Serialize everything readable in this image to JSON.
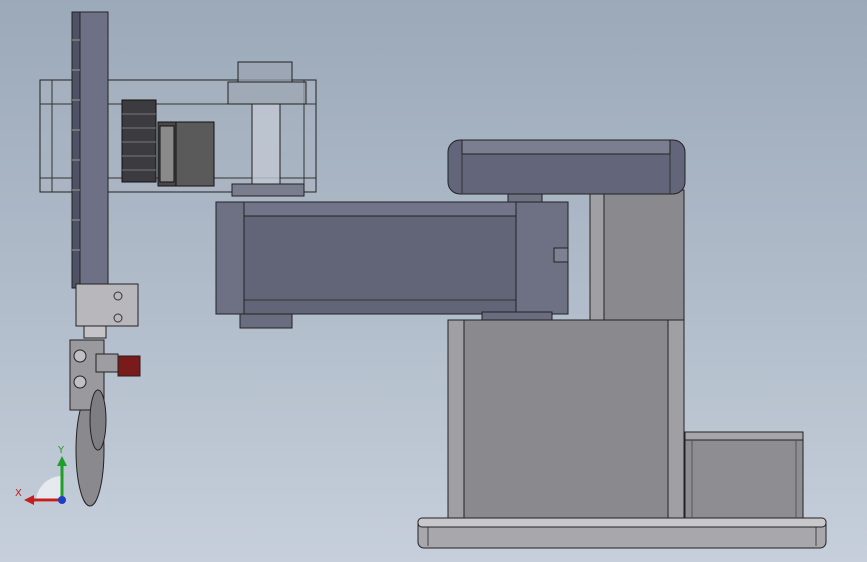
{
  "viewport": {
    "background_top": "#9ba9b9",
    "background_bottom": "#c6cfdb"
  },
  "model": {
    "parts": [
      "vertical-rack-shaft",
      "motor-gear-housing",
      "stepper-motor",
      "upper-arm-link",
      "base-column",
      "base-cap",
      "base-plate",
      "side-electronics-box",
      "end-effector-gripper",
      "gripper-mount-block"
    ],
    "colors": {
      "part_face": "#8e8e92",
      "part_dark": "#5f6272",
      "edge": "#1e1e22",
      "motor": "#4a4a4a",
      "accent_red": "#7a1a1a"
    }
  },
  "triad": {
    "x_label": "X",
    "y_label": "Y",
    "x_color": "#c41e1e",
    "y_color": "#1f9e2a",
    "z_color": "#1e3ec4"
  }
}
